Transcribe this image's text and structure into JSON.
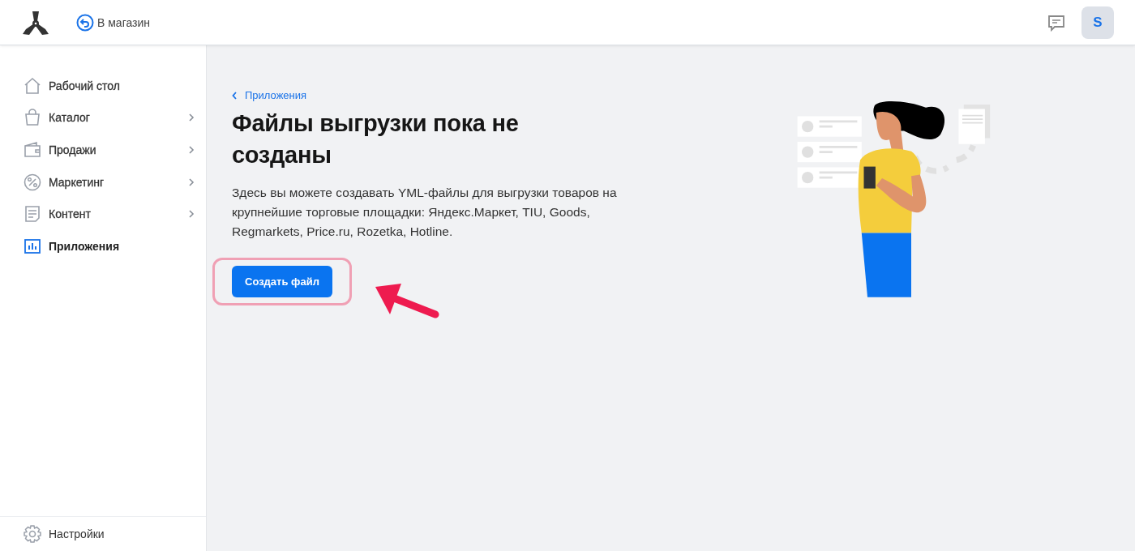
{
  "header": {
    "back_link": "В магазин",
    "avatar": "S"
  },
  "sidebar": {
    "items": [
      {
        "label": "Рабочий стол",
        "selected": false,
        "expandable": false
      },
      {
        "label": "Каталог",
        "selected": false,
        "expandable": true
      },
      {
        "label": "Продажи",
        "selected": false,
        "expandable": true
      },
      {
        "label": "Маркетинг",
        "selected": false,
        "expandable": true
      },
      {
        "label": "Контент",
        "selected": false,
        "expandable": true
      },
      {
        "label": "Приложения",
        "selected": true,
        "expandable": false
      }
    ],
    "footer_item": "Настройки"
  },
  "main": {
    "breadcrumb": "Приложения",
    "title": "Файлы выгрузки пока не созданы",
    "description": "Здесь вы можете создавать YML-файлы для выгрузки товаров на крупнейшие торговые площадки: Яндекс.Маркет, TIU, Goods, Regmarkets, Price.ru, Rozetka, Hotline.",
    "button": "Создать файл"
  }
}
